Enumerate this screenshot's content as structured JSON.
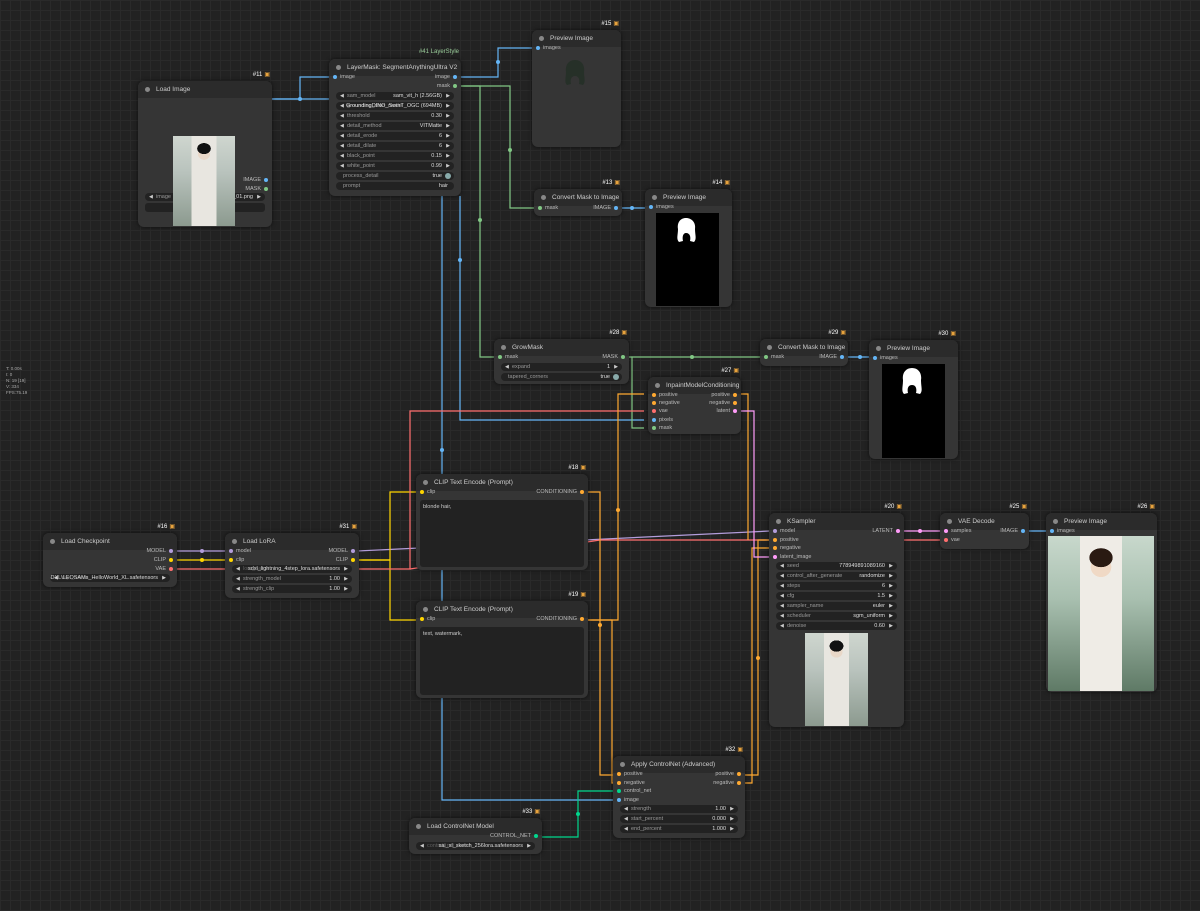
{
  "colors": {
    "image_link": "#64b5f6",
    "mask_link": "#81c784",
    "clip_link": "#ffd500",
    "conditioning_link": "#ffa931",
    "model_link": "#b39ddb",
    "vae_link": "#ff6e6e",
    "latent_link": "#ff9cf9",
    "control_net_link": "#00d78d"
  },
  "stats": {
    "text": "T: 0.00s\nI: 0\nN: 19 [19]\nV: 334\nFPS:75.19"
  },
  "nodes": {
    "load_image": {
      "title": "Load Image",
      "id": "#11",
      "outputs": [
        "IMAGE",
        "MASK"
      ],
      "image_label": "image",
      "image_value": "takase_hana_01.png",
      "upload_label": "choose file to upload"
    },
    "segment": {
      "title": "LayerMask: SegmentAnythingUltra V2",
      "id": "#41 LayerStyle",
      "input": "image",
      "outputs": [
        "image",
        "mask"
      ],
      "widgets": [
        {
          "label": "sam_model",
          "value": "sam_vit_h (2.56GB)"
        },
        {
          "label": "grounding_dino_model",
          "value": "GroundingDINO_SwinT_OGC (694MB)"
        },
        {
          "label": "threshold",
          "value": "0.30"
        },
        {
          "label": "detail_method",
          "value": "VITMatte"
        },
        {
          "label": "detail_erode",
          "value": "6"
        },
        {
          "label": "detail_dilate",
          "value": "6"
        },
        {
          "label": "black_point",
          "value": "0.15"
        },
        {
          "label": "white_point",
          "value": "0.99"
        }
      ],
      "process_detail_label": "process_detail",
      "process_detail_value": "true",
      "prompt_label": "prompt",
      "prompt_value": "hair"
    },
    "preview15": {
      "title": "Preview Image",
      "id": "#15",
      "input": "images"
    },
    "convert13": {
      "title": "Convert Mask to Image",
      "id": "#13",
      "input": "mask",
      "output": "IMAGE"
    },
    "preview14": {
      "title": "Preview Image",
      "id": "#14",
      "input": "images"
    },
    "growmask": {
      "title": "GrowMask",
      "id": "#28",
      "input": "mask",
      "output": "MASK",
      "expand_label": "expand",
      "expand_value": "1",
      "tapered_label": "tapered_corners",
      "tapered_value": "true"
    },
    "convert29": {
      "title": "Convert Mask to Image",
      "id": "#29",
      "input": "mask",
      "output": "IMAGE"
    },
    "preview30": {
      "title": "Preview Image",
      "id": "#30",
      "input": "images"
    },
    "inpaint": {
      "title": "InpaintModelConditioning",
      "id": "#27",
      "inputs": [
        "positive",
        "negative",
        "vae",
        "pixels",
        "mask"
      ],
      "outputs": [
        "positive",
        "negative",
        "latent"
      ]
    },
    "clip18": {
      "title": "CLIP Text Encode (Prompt)",
      "id": "#18",
      "input": "clip",
      "output": "CONDITIONING",
      "text": "blonde hair,"
    },
    "clip19": {
      "title": "CLIP Text Encode (Prompt)",
      "id": "#19",
      "input": "clip",
      "output": "CONDITIONING",
      "text": "text, watermark,"
    },
    "checkpoint": {
      "title": "Load Checkpoint",
      "id": "#16",
      "outputs": [
        "MODEL",
        "CLIP",
        "VAE"
      ],
      "ckpt_label": "ckpt_name",
      "ckpt_value": "SDXL\\LEOSAMs_HelloWorld_XL.safetensors"
    },
    "lora": {
      "title": "Load LoRA",
      "id": "#31",
      "inputs": [
        "model",
        "clip"
      ],
      "outputs": [
        "MODEL",
        "CLIP"
      ],
      "lora_label": "lora_name",
      "lora_value": "sdxl_lightning_4step_lora.safetensors",
      "strength_model_label": "strength_model",
      "strength_model_value": "1.00",
      "strength_clip_label": "strength_clip",
      "strength_clip_value": "1.00"
    },
    "ksampler": {
      "title": "KSampler",
      "id": "#20",
      "inputs": [
        "model",
        "positive",
        "negative",
        "latent_image"
      ],
      "output": "LATENT",
      "widgets": [
        {
          "label": "seed",
          "value": "778949891089160"
        },
        {
          "label": "control_after_generate",
          "value": "randomize"
        },
        {
          "label": "steps",
          "value": "6"
        },
        {
          "label": "cfg",
          "value": "1.5"
        },
        {
          "label": "sampler_name",
          "value": "euler"
        },
        {
          "label": "scheduler",
          "value": "sgm_uniform"
        },
        {
          "label": "denoise",
          "value": "0.60"
        }
      ]
    },
    "vaedecode": {
      "title": "VAE Decode",
      "id": "#25",
      "inputs": [
        "samples",
        "vae"
      ],
      "output": "IMAGE"
    },
    "preview26": {
      "title": "Preview Image",
      "id": "#26",
      "input": "images"
    },
    "controlnet_apply": {
      "title": "Apply ControlNet (Advanced)",
      "id": "#32",
      "inputs": [
        "positive",
        "negative",
        "control_net",
        "image"
      ],
      "outputs": [
        "positive",
        "negative"
      ],
      "widgets": [
        {
          "label": "strength",
          "value": "1.00"
        },
        {
          "label": "start_percent",
          "value": "0.000"
        },
        {
          "label": "end_percent",
          "value": "1.000"
        }
      ]
    },
    "controlnet_load": {
      "title": "Load ControlNet Model",
      "id": "#33",
      "output": "CONTROL_NET",
      "cn_label": "control_net_name",
      "cn_value": "sai_xl_sketch_256lora.safetensors"
    }
  }
}
